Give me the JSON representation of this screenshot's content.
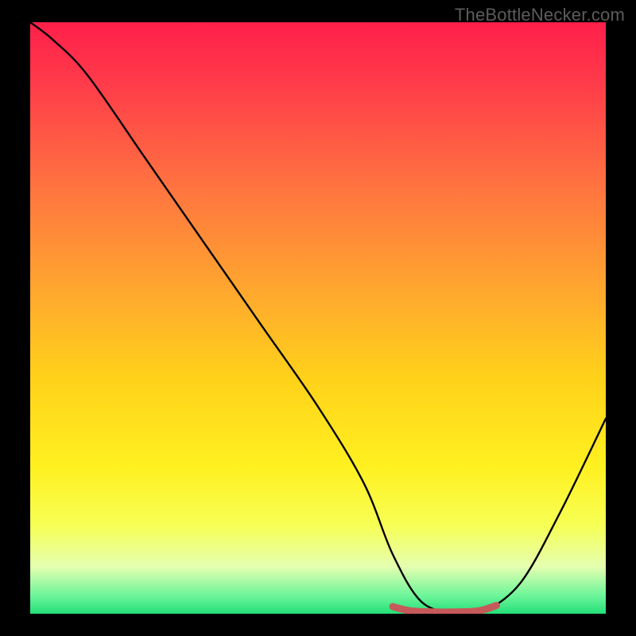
{
  "watermark": "TheBottleNecker.com",
  "chart_data": {
    "type": "line",
    "title": "",
    "xlabel": "",
    "ylabel": "",
    "xlim": [
      0,
      100
    ],
    "ylim": [
      0,
      100
    ],
    "series": [
      {
        "name": "bottleneck-curve",
        "x": [
          0,
          4,
          10,
          20,
          30,
          40,
          50,
          58,
          63,
          68,
          74,
          78,
          85,
          92,
          100
        ],
        "values": [
          100,
          97,
          91,
          77,
          63,
          49,
          35,
          22,
          10,
          2,
          0,
          0,
          5,
          17,
          33
        ]
      },
      {
        "name": "optimal-segment",
        "x": [
          63,
          66,
          70,
          74,
          78,
          81
        ],
        "values": [
          1.2,
          0.5,
          0.3,
          0.3,
          0.5,
          1.4
        ]
      }
    ],
    "colors": {
      "curve": "#000000",
      "optimal_segment": "#c65a5a",
      "background_gradient_top": "#ff1f4a",
      "background_gradient_bottom": "#23df77"
    }
  }
}
